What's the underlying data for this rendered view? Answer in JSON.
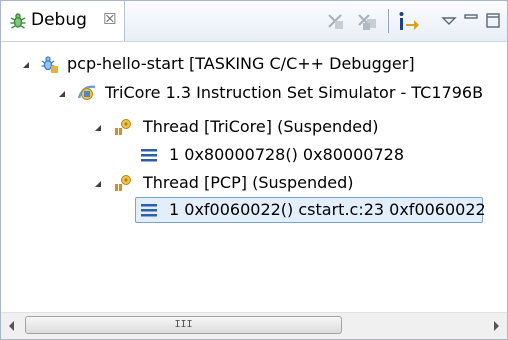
{
  "view": {
    "tab_label": "Debug",
    "tab_close_glyph": "☒",
    "tab_icon": "debug-bug-icon"
  },
  "toolbar": {
    "buttons": [
      {
        "name": "remove-terminated-icon"
      },
      {
        "name": "remove-all-terminated-icon"
      },
      {
        "name": "step-into-icon"
      },
      {
        "name": "view-menu-icon"
      },
      {
        "name": "minimize-icon"
      },
      {
        "name": "maximize-icon"
      }
    ]
  },
  "tree": {
    "items": [
      {
        "label": "pcp-hello-start [TASKING C/C++ Debugger]",
        "icon": "launch-config-icon",
        "expanded": true,
        "level": 0
      },
      {
        "label": "TriCore 1.3 Instruction Set Simulator - TC1796B",
        "icon": "debug-target-icon",
        "expanded": true,
        "level": 1
      },
      {
        "label": "Thread [TriCore] (Suspended)",
        "icon": "thread-suspended-icon",
        "expanded": true,
        "level": 2
      },
      {
        "label": "1 0x80000728()  0x80000728",
        "icon": "stack-frame-icon",
        "expanded": false,
        "level": 3
      },
      {
        "label": "Thread [PCP] (Suspended)",
        "icon": "thread-suspended-icon",
        "expanded": true,
        "level": 2
      },
      {
        "label": "1 0xf0060022() cstart.c:23 0xf0060022",
        "icon": "stack-frame-icon",
        "expanded": false,
        "level": 3,
        "selected": true
      }
    ]
  },
  "scrollbar": {
    "grip": "III"
  },
  "colors": {
    "selection_bg": "#e3eefb",
    "selection_border": "#7da2ce",
    "frame_icon": "#2b5fa8"
  }
}
